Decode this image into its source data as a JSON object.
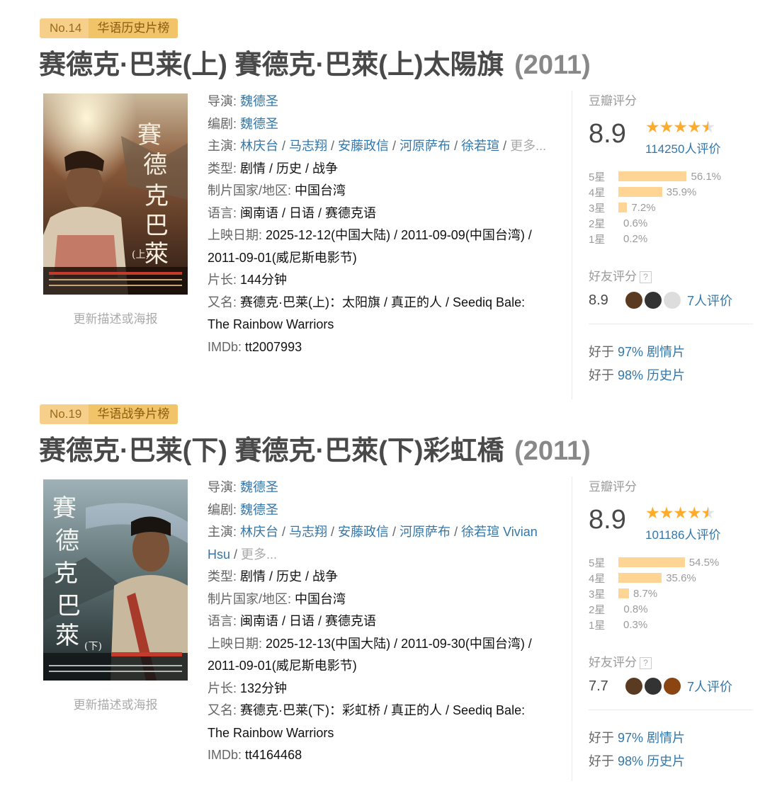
{
  "movies": [
    {
      "rank": "No.14",
      "chart_name": "华语历史片榜",
      "title": "赛德克·巴莱(上) 賽德克·巴萊(上)太陽旗",
      "year": "(2011)",
      "update_link": "更新描述或海报",
      "labels": {
        "director": "导演: ",
        "writer": "编剧: ",
        "cast": "主演: ",
        "genre": "类型: ",
        "country": "制片国家/地区: ",
        "language": "语言: ",
        "release": "上映日期: ",
        "runtime": "片长: ",
        "aka": "又名: ",
        "imdb": "IMDb: "
      },
      "director": "魏德圣",
      "writer": "魏德圣",
      "cast": [
        "林庆台",
        "马志翔",
        "安藤政信",
        "河原萨布",
        "徐若瑄"
      ],
      "cast_more": "更多...",
      "genre": "剧情 / 历史 / 战争",
      "country": "中国台湾",
      "language": "闽南语 / 日语 / 赛德克语",
      "release_line1": "2025-12-12(中国大陆) / 2011-09-09(中国台湾) /",
      "release_line2": "2011-09-01(威尼斯电影节)",
      "runtime": "144分钟",
      "aka_line1": "赛德克·巴莱(上)：太阳旗 / 真正的人 / Seediq Bale:",
      "aka_line2": "The Rainbow Warriors",
      "imdb": "tt2007993",
      "rating_label": "豆瓣评分",
      "score": "8.9",
      "stars": 4.5,
      "votes": "114250人评价",
      "distribution": [
        {
          "label": "5星",
          "pct": "56.1%",
          "value": 56.1
        },
        {
          "label": "4星",
          "pct": "35.9%",
          "value": 35.9
        },
        {
          "label": "3星",
          "pct": "7.2%",
          "value": 7.2
        },
        {
          "label": "2星",
          "pct": "0.6%",
          "value": 0.6
        },
        {
          "label": "1星",
          "pct": "0.2%",
          "value": 0.2
        }
      ],
      "friend_label": "好友评分",
      "friend_help": "?",
      "friend_score": "8.9",
      "friend_count": "7人评价",
      "avatars": [
        "#5a3a20",
        "#333333",
        "#dddddd"
      ],
      "better": [
        {
          "prefix": "好于 ",
          "pct": "97%",
          "genre": "剧情片"
        },
        {
          "prefix": "好于 ",
          "pct": "98%",
          "genre": "历史片"
        }
      ]
    },
    {
      "rank": "No.19",
      "chart_name": "华语战争片榜",
      "title": "赛德克·巴莱(下) 賽德克·巴萊(下)彩虹橋",
      "year": "(2011)",
      "update_link": "更新描述或海报",
      "labels": {
        "director": "导演: ",
        "writer": "编剧: ",
        "cast": "主演: ",
        "genre": "类型: ",
        "country": "制片国家/地区: ",
        "language": "语言: ",
        "release": "上映日期: ",
        "runtime": "片长: ",
        "aka": "又名: ",
        "imdb": "IMDb: "
      },
      "director": "魏德圣",
      "writer": "魏德圣",
      "cast": [
        "林庆台",
        "马志翔",
        "安藤政信",
        "河原萨布",
        "徐若瑄",
        "Vivian Hsu"
      ],
      "cast_more": "更多...",
      "genre": "剧情 / 历史 / 战争",
      "country": "中国台湾",
      "language": "闽南语 / 日语 / 赛德克语",
      "release_line1": "2025-12-13(中国大陆) / 2011-09-30(中国台湾) /",
      "release_line2": "2011-09-01(威尼斯电影节)",
      "runtime": "132分钟",
      "aka_line1": "赛德克·巴莱(下)：彩虹桥 / 真正的人 / Seediq Bale:",
      "aka_line2": "The Rainbow Warriors",
      "imdb": "tt4164468",
      "rating_label": "豆瓣评分",
      "score": "8.9",
      "stars": 4.5,
      "votes": "101186人评价",
      "distribution": [
        {
          "label": "5星",
          "pct": "54.5%",
          "value": 54.5
        },
        {
          "label": "4星",
          "pct": "35.6%",
          "value": 35.6
        },
        {
          "label": "3星",
          "pct": "8.7%",
          "value": 8.7
        },
        {
          "label": "2星",
          "pct": "0.8%",
          "value": 0.8
        },
        {
          "label": "1星",
          "pct": "0.3%",
          "value": 0.3
        }
      ],
      "friend_label": "好友评分",
      "friend_help": "?",
      "friend_score": "7.7",
      "friend_count": "7人评价",
      "avatars": [
        "#5a3a20",
        "#333333",
        "#8b4513"
      ],
      "better": [
        {
          "prefix": "好于 ",
          "pct": "97%",
          "genre": "剧情片"
        },
        {
          "prefix": "好于 ",
          "pct": "98%",
          "genre": "历史片"
        }
      ]
    }
  ],
  "colors": {
    "link": "#3377aa",
    "star": "#ffac2d",
    "bar": "#ffd596",
    "badge": "#f6d08a"
  }
}
